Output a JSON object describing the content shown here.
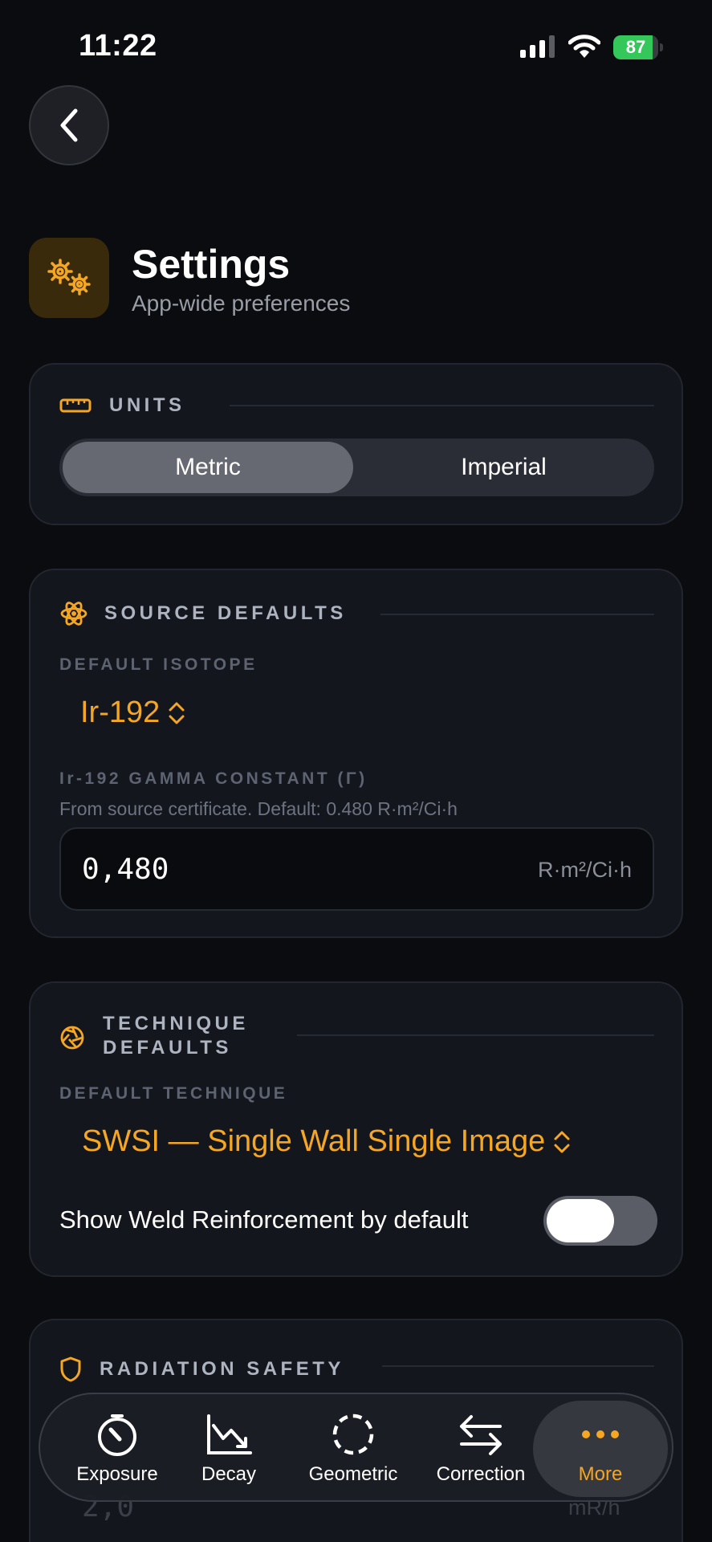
{
  "status_bar": {
    "time": "11:22",
    "battery": "87",
    "battery_level": 0.87
  },
  "header": {
    "title": "Settings",
    "subtitle": "App-wide preferences"
  },
  "units": {
    "title": "UNITS",
    "options": [
      "Metric",
      "Imperial"
    ],
    "selected": "Metric"
  },
  "source_defaults": {
    "title": "SOURCE DEFAULTS",
    "isotope_label": "DEFAULT ISOTOPE",
    "isotope_value": "Ir-192",
    "gamma_label": "Ir-192 GAMMA CONSTANT (Γ)",
    "gamma_hint": "From source certificate. Default: 0.480 R·m²/Ci·h",
    "gamma_value": "0,480",
    "gamma_unit": "R·m²/Ci·h"
  },
  "technique_defaults": {
    "title_line1": "TECHNIQUE",
    "title_line2": "DEFAULTS",
    "technique_label": "DEFAULT TECHNIQUE",
    "technique_value": "SWSI — Single Wall Single Image",
    "toggle_label": "Show Weld Reinforcement by default",
    "toggle_on": false
  },
  "radiation_safety": {
    "title": "RADIATION SAFETY",
    "partial_value": "2,0",
    "partial_unit": "mR/h"
  },
  "tab_bar": {
    "tabs": [
      {
        "label": "Exposure",
        "icon": "timer-icon"
      },
      {
        "label": "Decay",
        "icon": "decay-chart-icon"
      },
      {
        "label": "Geometric",
        "icon": "dashed-circle-icon"
      },
      {
        "label": "Correction",
        "icon": "swap-arrows-icon"
      },
      {
        "label": "More",
        "icon": "ellipsis-icon"
      }
    ],
    "active": "More"
  },
  "colors": {
    "accent": "#f5a623",
    "background": "#0b0c10",
    "card": "#13161d",
    "battery_green": "#34c759"
  }
}
